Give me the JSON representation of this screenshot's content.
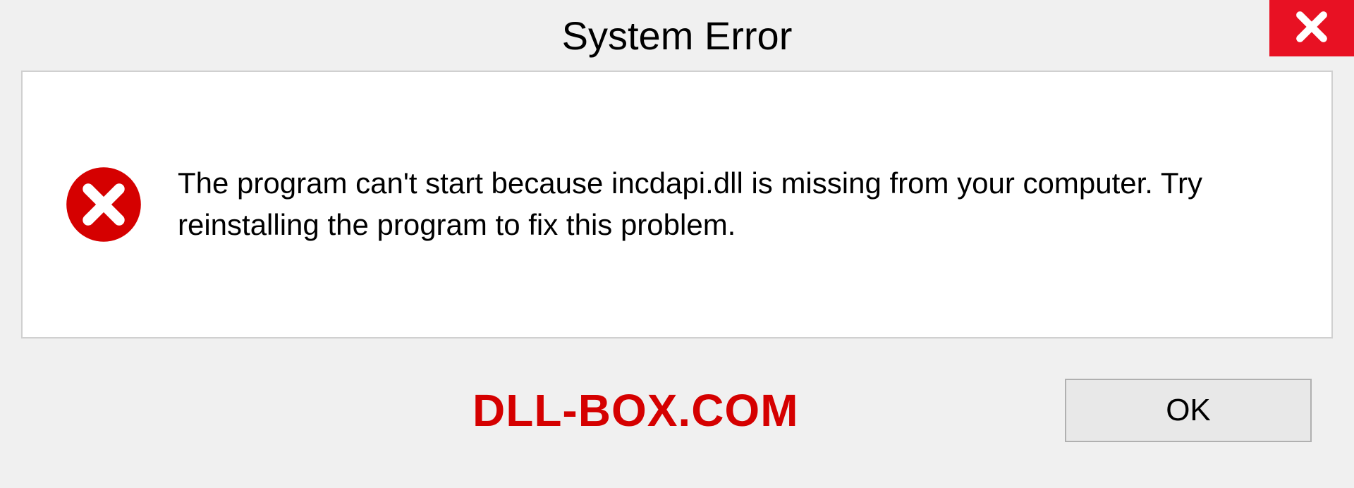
{
  "dialog": {
    "title": "System Error",
    "message": "The program can't start because incdapi.dll is missing from your computer. Try reinstalling the program to fix this problem.",
    "ok_label": "OK"
  },
  "watermark": "DLL-BOX.COM"
}
